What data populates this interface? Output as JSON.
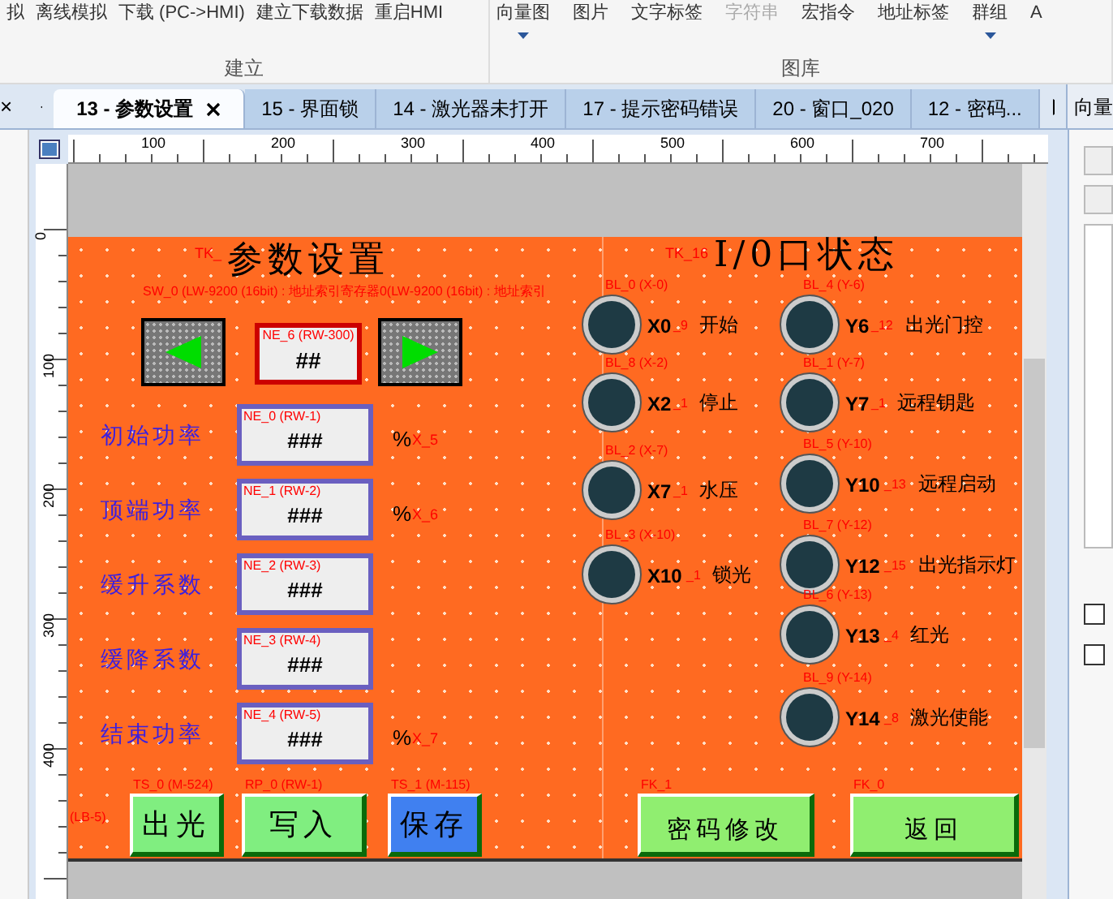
{
  "ribbon": {
    "groups": [
      {
        "label": "建立",
        "items": [
          {
            "text": "拟",
            "disabled": false,
            "dropdown": false
          },
          {
            "text": "离线模拟",
            "disabled": false,
            "dropdown": false
          },
          {
            "text": "下载 (PC->HMI)",
            "disabled": false,
            "dropdown": false
          },
          {
            "text": "建立下载数据",
            "disabled": false,
            "dropdown": false
          },
          {
            "text": "重启HMI",
            "disabled": false,
            "dropdown": false
          }
        ]
      },
      {
        "label": "图库",
        "items": [
          {
            "text": "向量图",
            "disabled": false,
            "dropdown": true
          },
          {
            "text": "图片",
            "disabled": false,
            "dropdown": false
          },
          {
            "text": "文字标签",
            "disabled": false,
            "dropdown": false
          },
          {
            "text": "字符串",
            "disabled": true,
            "dropdown": false
          },
          {
            "text": "宏指令",
            "disabled": false,
            "dropdown": false
          },
          {
            "text": "地址标签",
            "disabled": false,
            "dropdown": false
          },
          {
            "text": "群组",
            "disabled": false,
            "dropdown": true
          },
          {
            "text": "A",
            "disabled": false,
            "dropdown": false
          }
        ]
      }
    ]
  },
  "left_panel": {
    "close": "×"
  },
  "tabs": [
    {
      "label": "13 - 参数设置",
      "selected": true
    },
    {
      "label": "15 - 界面锁",
      "selected": false
    },
    {
      "label": "14 - 激光器未打开",
      "selected": false
    },
    {
      "label": "17 - 提示密码错误",
      "selected": false
    },
    {
      "label": "20 - 窗口_020",
      "selected": false
    },
    {
      "label": "12 - 密码...",
      "selected": false
    }
  ],
  "right_panel": {
    "title": "向量",
    "checkboxes": [
      {
        "checked": false
      },
      {
        "checked": false
      }
    ]
  },
  "ruler": {
    "h_labels": [
      "100",
      "200",
      "300",
      "400",
      "500",
      "600",
      "700"
    ],
    "v_labels": [
      "0",
      "100",
      "200",
      "300",
      "400"
    ]
  },
  "screen": {
    "title_left": "参数设置",
    "title_left_tag": "TK_",
    "title_right": "I/0口状态",
    "title_right_tag": "TK_16",
    "index_tag": "SW_0 (LW-9200 (16bit) : 地址索引寄存器0(LW-9200 (16bit) : 地址索引",
    "index_box": {
      "tag": "NE_6 (RW-300)",
      "value": "##"
    },
    "params": [
      {
        "label": "初始功率",
        "tag": "NE_0 (RW-1)",
        "value": "###",
        "unit": "%",
        "unit_tag": "X_5"
      },
      {
        "label": "顶端功率",
        "tag": "NE_1 (RW-2)",
        "value": "###",
        "unit": "%",
        "unit_tag": "X_6"
      },
      {
        "label": "缓升系数",
        "tag": "NE_2 (RW-3)",
        "value": "###"
      },
      {
        "label": "缓降系数",
        "tag": "NE_3 (RW-4)",
        "value": "###"
      },
      {
        "label": "结束功率",
        "tag": "NE_4 (RW-5)",
        "value": "###",
        "unit": "%",
        "unit_tag": "X_7"
      }
    ],
    "lb_tag": "(LB-5)",
    "buttons": [
      {
        "tag": "TS_0 (M-524)",
        "label": "出光",
        "color": "#80ee80"
      },
      {
        "tag": "RP_0 (RW-1)",
        "label": "写入",
        "color": "#80ee80"
      },
      {
        "tag": "TS_1 (M-115)",
        "label": "保存",
        "color": "#4080f0"
      },
      {
        "tag": "FK_1",
        "label": "密码修改",
        "color": "#90ee70"
      },
      {
        "tag": "FK_0",
        "label": "返回",
        "color": "#90ee70"
      }
    ],
    "lamps": [
      {
        "tag": "BL_0 (X-0)",
        "addr": "X0",
        "suffix": "_9",
        "label": "开始",
        "on": false
      },
      {
        "tag": "BL_8 (X-2)",
        "addr": "X2",
        "suffix": "_1",
        "label": "停止",
        "on": false
      },
      {
        "tag": "BL_2 (X-7)",
        "addr": "X7",
        "suffix": "_1",
        "label": "水压",
        "on": false
      },
      {
        "tag": "BL_3 (X-10)",
        "addr": "X10",
        "suffix": "_1",
        "label": "锁光",
        "on": false
      },
      {
        "tag": "BL_4 (Y-6)",
        "addr": "Y6",
        "suffix": "_12",
        "label": "出光门控",
        "on": false
      },
      {
        "tag": "BL_1 (Y-7)",
        "addr": "Y7",
        "suffix": "_1",
        "label": "远程钥匙",
        "on": false
      },
      {
        "tag": "BL_5 (Y-10)",
        "addr": "Y10",
        "suffix": "_13",
        "label": "远程启动",
        "on": false
      },
      {
        "tag": "BL_7 (Y-12)",
        "addr": "Y12",
        "suffix": "_15",
        "label": "出光指示灯",
        "on": false
      },
      {
        "tag": "BL_6 (Y-13)",
        "addr": "Y13",
        "suffix": "_4",
        "label": "红光",
        "on": false
      },
      {
        "tag": "BL_9 (Y-14)",
        "addr": "Y14",
        "suffix": "_8",
        "label": "激光使能",
        "on": false
      }
    ]
  }
}
